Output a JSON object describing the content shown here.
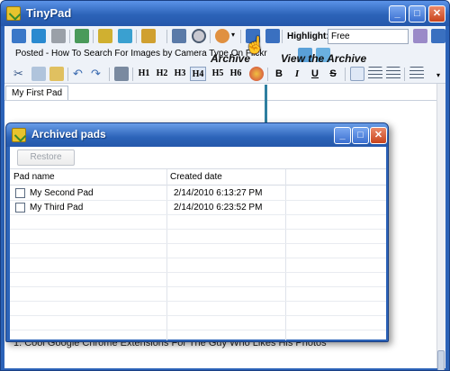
{
  "app": {
    "title": "TinyPad",
    "controls": {
      "minimize": "_",
      "maximize": "□",
      "close": "✕"
    }
  },
  "toolbar": {
    "highlight_label": "Highlight:",
    "highlight_value": "Free",
    "posted_text": "Posted - How To Search For Images by Camera Type On Flickr",
    "headings": [
      "H1",
      "H2",
      "H3",
      "H4",
      "H5",
      "H6"
    ],
    "text_format": [
      "B",
      "I",
      "U",
      "S"
    ],
    "selected_heading": "H4"
  },
  "tabs": [
    {
      "label": "My First Pad"
    }
  ],
  "annotations": {
    "archive": "Archive",
    "view_archive": "View the Archive"
  },
  "background_text": {
    "line1": "1. Cool Google Chrome Extensions For The Guy Who Likes His Photos",
    "line2": ""
  },
  "dialog": {
    "title": "Archived pads",
    "restore_button": "Restore",
    "columns": [
      "Pad name",
      "Created date"
    ],
    "rows": [
      {
        "name": "My Second Pad",
        "date": "2/14/2010 6:13:27 PM"
      },
      {
        "name": "My Third Pad",
        "date": "2/14/2010 6:23:52 PM"
      }
    ]
  },
  "colors": {
    "titlebar": "#2c63b8",
    "arrow": "#2e7fa0",
    "close_button": "#c8431c"
  }
}
